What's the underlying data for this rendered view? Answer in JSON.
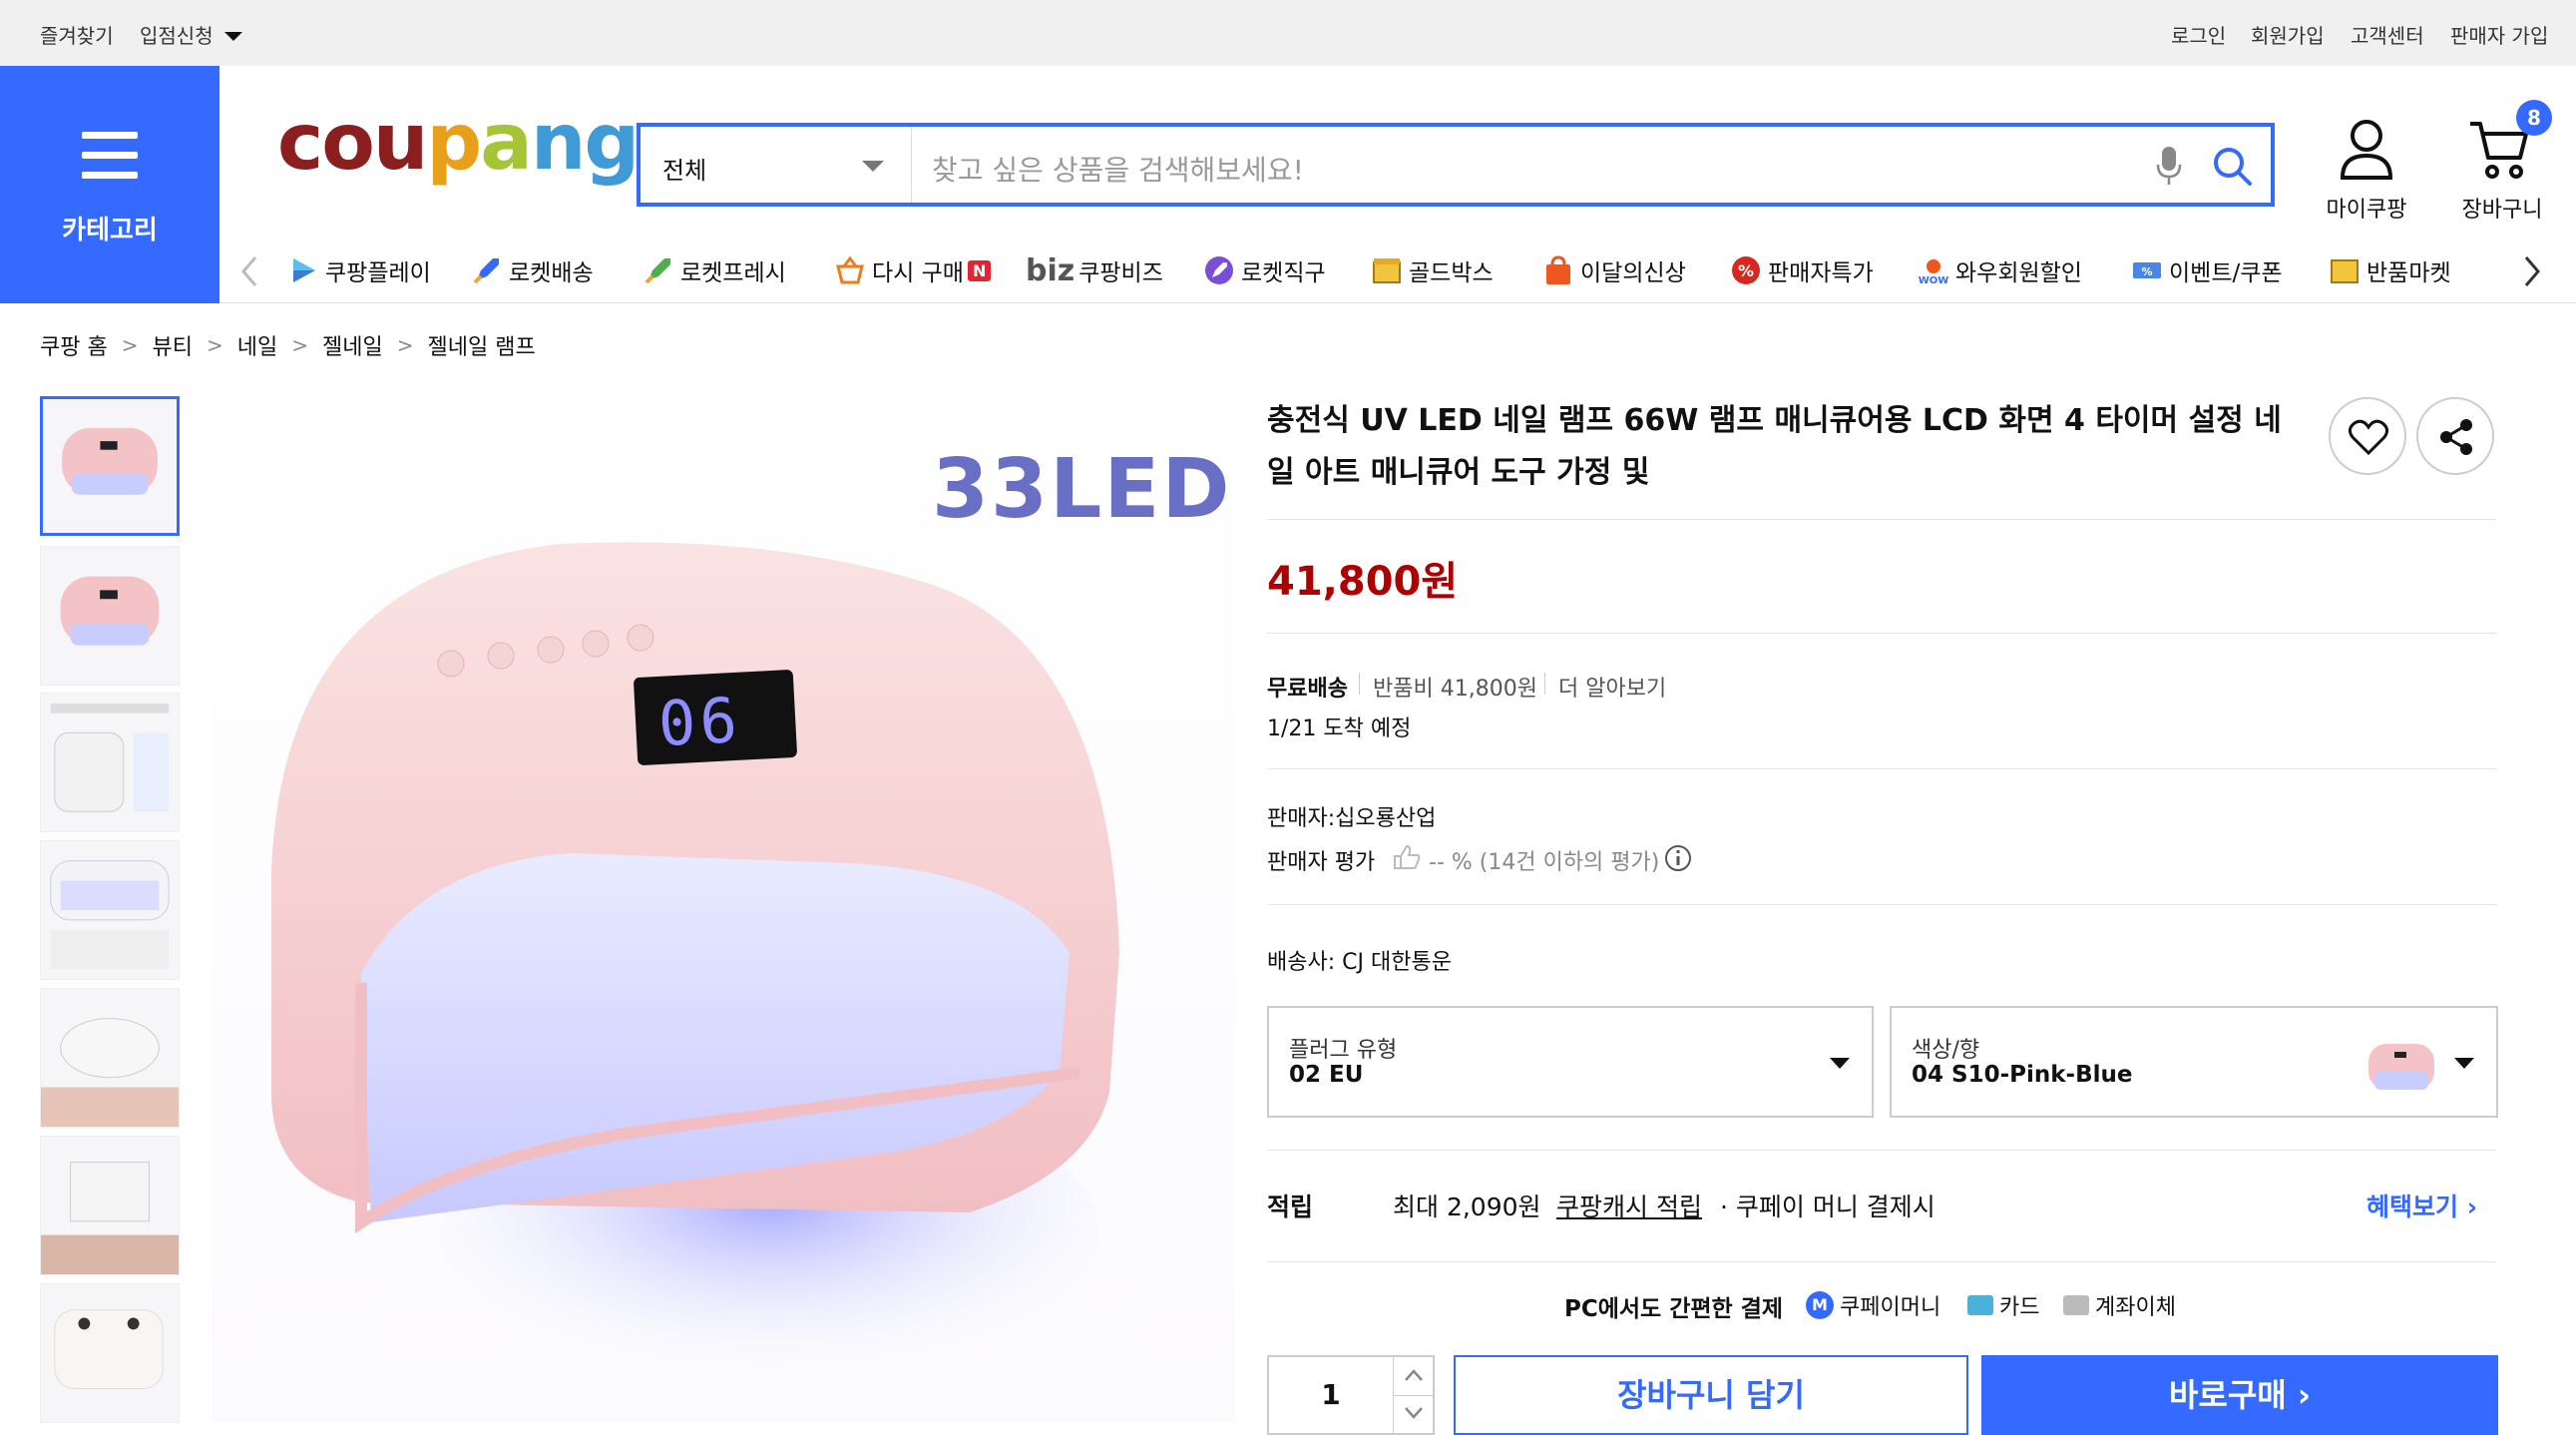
{
  "topbar": {
    "left": [
      "즐겨찾기",
      "입점신청"
    ],
    "right": [
      "로그인",
      "회원가입",
      "고객센터",
      "판매자 가입"
    ]
  },
  "header": {
    "category_label": "카테고리",
    "logo": "coupang",
    "search": {
      "category": "전체",
      "placeholder": "찾고 싶은 상품을 검색해보세요!"
    },
    "mypage_label": "마이쿠팡",
    "cart_label": "장바구니",
    "cart_count": "8"
  },
  "nav": [
    {
      "label": "쿠팡플레이",
      "icon": "play-icon"
    },
    {
      "label": "로켓배송",
      "icon": "rocket-icon"
    },
    {
      "label": "로켓프레시",
      "icon": "rocket-fresh-icon"
    },
    {
      "label": "다시 구매",
      "icon": "basket-icon"
    },
    {
      "label": "쿠팡비즈",
      "icon": "biz-icon"
    },
    {
      "label": "로켓직구",
      "icon": "rocket-global-icon"
    },
    {
      "label": "골드박스",
      "icon": "goldbox-icon"
    },
    {
      "label": "이달의신상",
      "icon": "new-bag-icon"
    },
    {
      "label": "판매자특가",
      "icon": "percent-icon"
    },
    {
      "label": "와우회원할인",
      "icon": "wow-icon"
    },
    {
      "label": "이벤트/쿠폰",
      "icon": "coupon-icon"
    },
    {
      "label": "반품마켓",
      "icon": "return-market-icon"
    }
  ],
  "nav_badges": {
    "n": "N",
    "biz": "biz"
  },
  "breadcrumb": [
    "쿠팡 홈",
    "뷰티",
    "네일",
    "젤네일",
    "젤네일 램프"
  ],
  "image": {
    "overlay": "33LED",
    "display": "06"
  },
  "product": {
    "title": "충전식 UV LED 네일 램프 66W 램프 매니큐어용 LCD 화면 4 타이머 설정 네일 아트 매니큐어 도구 가정 및",
    "price": "41,800원",
    "shipping": {
      "free": "무료배송",
      "return_fee": "반품비 41,800원",
      "more": "더 알아보기",
      "arrival": "1/21 도착 예정"
    },
    "seller": "판매자:십오룡산업",
    "seller_rating_label": "판매자 평가",
    "seller_rating_value": "-- % (14건 이하의 평가)",
    "courier": "배송사:  CJ 대한통운",
    "options": [
      {
        "label": "플러그 유형",
        "value": "02 EU"
      },
      {
        "label": "색상/향",
        "value": "04 S10-Pink-Blue"
      }
    ],
    "points": {
      "label": "적립",
      "max": "최대 2,090원",
      "cash": "쿠팡캐시 적립",
      "pay": "· 쿠페이 머니 결제시",
      "benefit": "혜택보기"
    },
    "payment": {
      "title": "PC에서도 간편한 결제",
      "money": "쿠페이머니",
      "card": "카드",
      "transfer": "계좌이체",
      "m_badge": "M"
    },
    "quantity": "1",
    "cart_button": "장바구니 담기",
    "buy_button": "바로구매"
  },
  "colors": {
    "accent": "#346aff",
    "price": "#ae0000"
  }
}
